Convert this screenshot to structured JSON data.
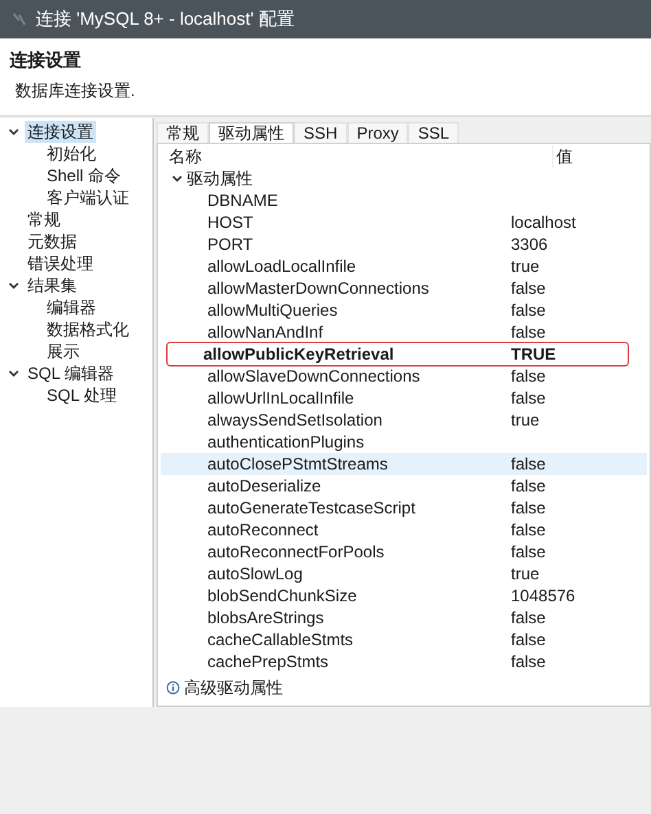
{
  "window": {
    "title": "连接 'MySQL 8+ - localhost' 配置"
  },
  "header": {
    "title": "连接设置",
    "description": "数据库连接设置."
  },
  "tree": [
    {
      "label": "连接设置",
      "selected": true,
      "expanded": true,
      "children": [
        {
          "label": "初始化",
          "selected": false
        },
        {
          "label": "Shell 命令",
          "selected": false
        },
        {
          "label": "客户端认证",
          "selected": false
        }
      ]
    },
    {
      "label": "常规",
      "selected": false
    },
    {
      "label": "元数据",
      "selected": false
    },
    {
      "label": "错误处理",
      "selected": false
    },
    {
      "label": "结果集",
      "selected": false,
      "expanded": true,
      "children": [
        {
          "label": "编辑器",
          "selected": false
        },
        {
          "label": "数据格式化",
          "selected": false
        },
        {
          "label": "展示",
          "selected": false
        }
      ]
    },
    {
      "label": "SQL 编辑器",
      "selected": false,
      "expanded": true,
      "children": [
        {
          "label": "SQL 处理",
          "selected": false
        }
      ]
    }
  ],
  "tabs": [
    {
      "label": "常规",
      "selected": false
    },
    {
      "label": "驱动属性",
      "selected": true
    },
    {
      "label": "SSH",
      "selected": false
    },
    {
      "label": "Proxy",
      "selected": false
    },
    {
      "label": "SSL",
      "selected": false
    }
  ],
  "table": {
    "columns": [
      "名称",
      "值"
    ],
    "group": {
      "label": "驱动属性",
      "expanded": true,
      "rows": [
        {
          "name": "DBNAME",
          "selected": false,
          "marked": false
        },
        {
          "name": "HOST",
          "value": "localhost",
          "selected": false,
          "marked": false
        },
        {
          "name": "PORT",
          "value": "3306",
          "selected": false,
          "marked": false
        },
        {
          "name": "allowLoadLocalInfile",
          "value": "true",
          "selected": false,
          "marked": false
        },
        {
          "name": "allowMasterDownConnections",
          "value": "false",
          "selected": false,
          "marked": false
        },
        {
          "name": "allowMultiQueries",
          "value": "false",
          "selected": false,
          "marked": false
        },
        {
          "name": "allowNanAndInf",
          "value": "false",
          "selected": false,
          "marked": false
        },
        {
          "name": "allowPublicKeyRetrieval",
          "value": "TRUE",
          "selected": false,
          "marked": true
        },
        {
          "name": "allowSlaveDownConnections",
          "value": "false",
          "selected": false,
          "marked": false
        },
        {
          "name": "allowUrlInLocalInfile",
          "value": "false",
          "selected": false,
          "marked": false
        },
        {
          "name": "alwaysSendSetIsolation",
          "value": "true",
          "selected": false,
          "marked": false
        },
        {
          "name": "authenticationPlugins",
          "selected": false,
          "marked": false
        },
        {
          "name": "autoClosePStmtStreams",
          "value": "false",
          "selected": true,
          "marked": false
        },
        {
          "name": "autoDeserialize",
          "value": "false",
          "selected": false,
          "marked": false
        },
        {
          "name": "autoGenerateTestcaseScript",
          "value": "false",
          "selected": false,
          "marked": false
        },
        {
          "name": "autoReconnect",
          "value": "false",
          "selected": false,
          "marked": false
        },
        {
          "name": "autoReconnectForPools",
          "value": "false",
          "selected": false,
          "marked": false
        },
        {
          "name": "autoSlowLog",
          "value": "true",
          "selected": false,
          "marked": false
        },
        {
          "name": "blobSendChunkSize",
          "value": "1048576",
          "selected": false,
          "marked": false
        },
        {
          "name": "blobsAreStrings",
          "value": "false",
          "selected": false,
          "marked": false
        },
        {
          "name": "cacheCallableStmts",
          "value": "false",
          "selected": false,
          "marked": false
        },
        {
          "name": "cachePrepStmts",
          "value": "false",
          "selected": false,
          "marked": false
        }
      ]
    }
  },
  "footer": {
    "label": "高级驱动属性"
  }
}
